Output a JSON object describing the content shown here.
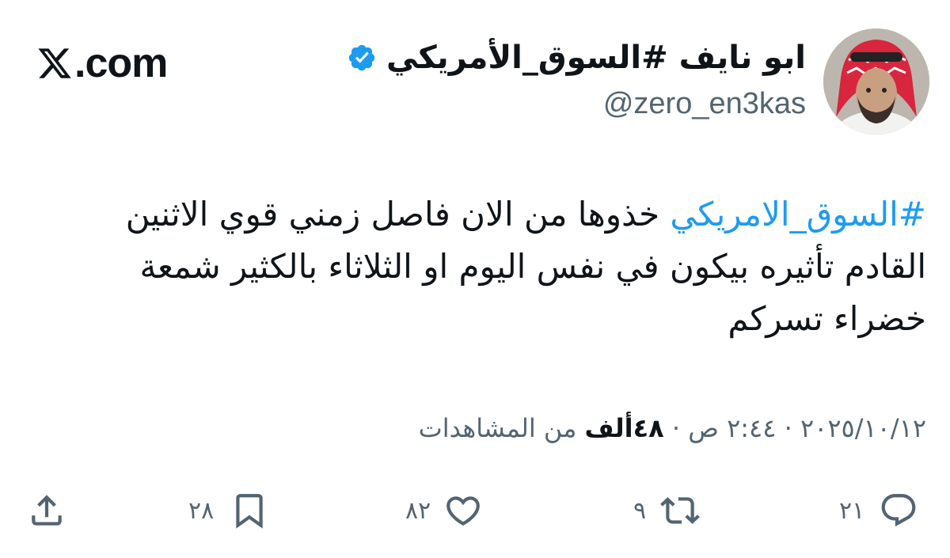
{
  "brand": {
    "logo_text": ".com",
    "logo_icon": "x-logo-icon"
  },
  "author": {
    "display_name": "ابو نايف #السوق_الأمريكي",
    "handle": "@zero_en3kas",
    "verified_color": "#1d9bf0"
  },
  "tweet": {
    "hashtag": "#السوق_الامريكي",
    "text": " خذوها من الان فاصل زمني قوي الاثنين القادم تأثيره بيكون في نفس اليوم او الثلاثاء بالكثير شمعة خضراء تسركم"
  },
  "meta": {
    "date": "٢٠٢٥/١٠/١٢",
    "separator": " · ",
    "time": "٢:٤٤ ص",
    "views": "٤٨ألف",
    "views_label": " من المشاهدات"
  },
  "actions": {
    "replies": "٢١",
    "retweets": "٩",
    "likes": "٨٢",
    "bookmarks": "٢٨"
  },
  "colors": {
    "accent": "#1d9bf0",
    "text": "#0f1419",
    "muted": "#536471"
  }
}
